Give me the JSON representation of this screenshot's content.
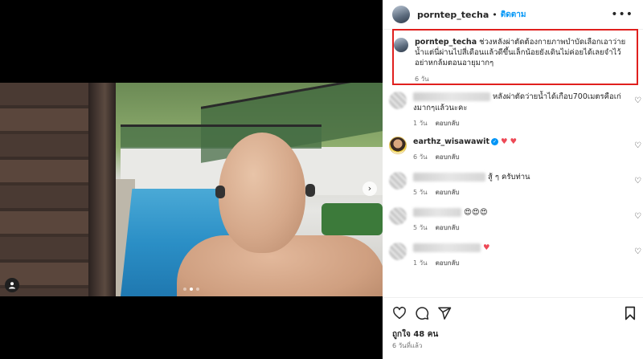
{
  "header": {
    "username": "porntep_techa",
    "separator": "•",
    "follow_label": "ติดตาม",
    "more_label": "•••"
  },
  "caption": {
    "username": "porntep_techa",
    "text": "ช่วงหลังผ่าตัดต้องกายภาพบำบัดเลือกเอาว่ายน้ำแต่นี่ผ่านไปสี่เดือนแล้วดีขึ้นเล็กน้อยยังเดินไม่ค่อยได้เลยจำไว้อย่าหกล้มตอนอายุมากๆ",
    "time": "6 วัน"
  },
  "comments": [
    {
      "username": "",
      "text": "หลังผ่าตัดว่ายน้ำได้เกือบ700เมตรคือเก่งมากๆแล้วนะคะ",
      "time": "1 วัน",
      "reply": "ตอบกลับ"
    },
    {
      "username": "earthz_wisawawit",
      "verified": "✓",
      "text": "♥ ♥",
      "time": "6 วัน",
      "reply": "ตอบกลับ"
    },
    {
      "username": "",
      "text": "สู้ ๆ ครับท่าน",
      "time": "5 วัน",
      "reply": "ตอบกลับ"
    },
    {
      "username": "",
      "text": "😍😍😍",
      "time": "5 วัน",
      "reply": "ตอบกลับ"
    },
    {
      "username": "",
      "text": "♥",
      "time": "1 วัน",
      "reply": "ตอบกลับ"
    }
  ],
  "footer": {
    "likes": "ถูกใจ 48 คน",
    "posted": "6 วันที่แล้ว"
  },
  "media": {
    "next_glyph": "›",
    "carousel_total": 3,
    "carousel_current": 2
  },
  "colors": {
    "accent": "#0095f6",
    "highlight_border": "#e0201e",
    "like_red": "#ed4956"
  }
}
